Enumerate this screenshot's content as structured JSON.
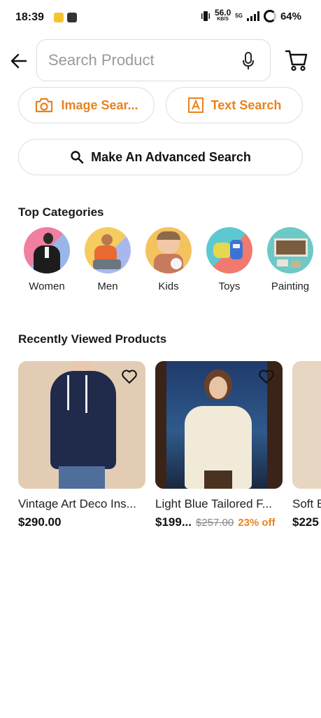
{
  "status_bar": {
    "time": "18:39",
    "speed_value": "56.0",
    "speed_unit": "KB/S",
    "network_label": "5G",
    "battery": "64%"
  },
  "search": {
    "placeholder": "Search Product"
  },
  "actions": {
    "image_search": "Image Sear...",
    "text_search": "Text Search",
    "advanced_search": "Make An Advanced Search"
  },
  "categories": {
    "title": "Top Categories",
    "items": [
      {
        "label": "Women",
        "icon": "women-category-image"
      },
      {
        "label": "Men",
        "icon": "men-category-image"
      },
      {
        "label": "Kids",
        "icon": "kids-category-image"
      },
      {
        "label": "Toys",
        "icon": "toys-category-image"
      },
      {
        "label": "Painting",
        "icon": "painting-category-image"
      }
    ]
  },
  "recent": {
    "title": "Recently Viewed Products",
    "items": [
      {
        "title": "Vintage Art Deco Ins...",
        "price": "$290.00",
        "old_price": "",
        "discount": ""
      },
      {
        "title": "Light Blue Tailored F...",
        "price": "$199...",
        "old_price": "$257.00",
        "discount": "23% off"
      },
      {
        "title": "Soft B",
        "price": "$225",
        "old_price": "",
        "discount": ""
      }
    ]
  },
  "colors": {
    "accent": "#e8821e",
    "text": "#1a1a1a",
    "border": "#dedede"
  }
}
